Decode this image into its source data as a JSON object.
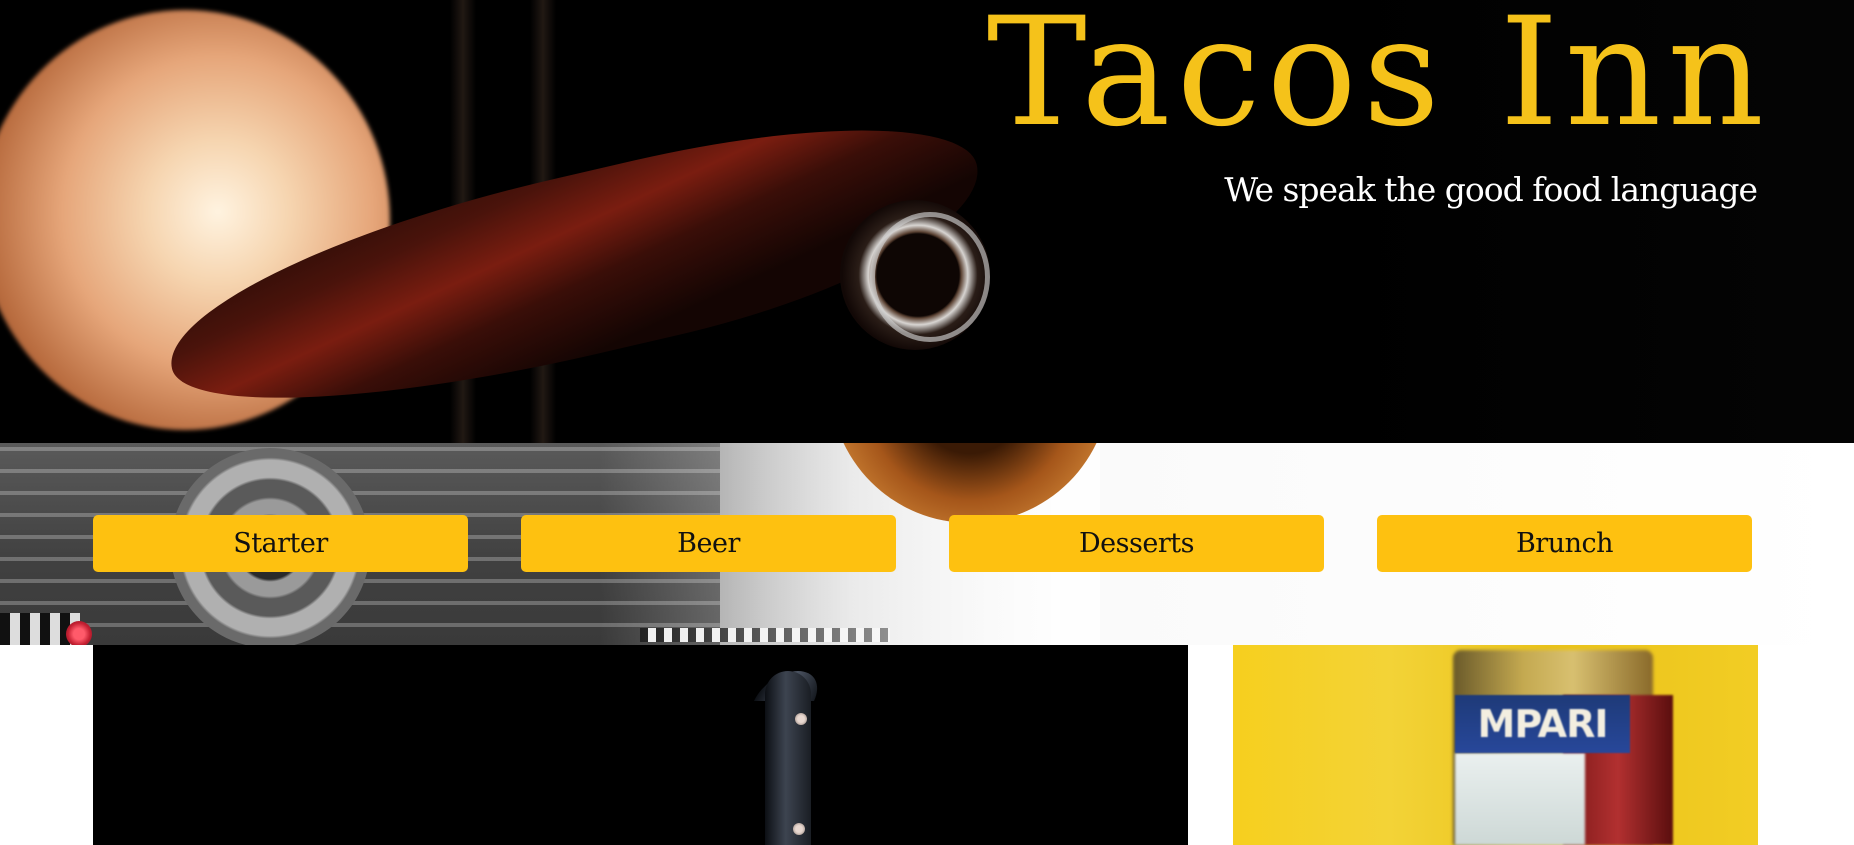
{
  "header": {
    "title": "Tacos Inn",
    "tagline": "We speak the good food language"
  },
  "nav": {
    "items": [
      {
        "label": "Starter"
      },
      {
        "label": "Beer"
      },
      {
        "label": "Desserts"
      },
      {
        "label": "Brunch"
      }
    ]
  },
  "colors": {
    "accent": "#fec110",
    "title": "#f5c21a",
    "hero_background": "#000000",
    "tagline": "#ffffff"
  },
  "images": {
    "hero": "beer-bottle-photo",
    "nav_background": "camera-photo",
    "content_left": "knife-photo",
    "content_right": "campari-bottle-photo",
    "content_right_label": "MPARI"
  }
}
